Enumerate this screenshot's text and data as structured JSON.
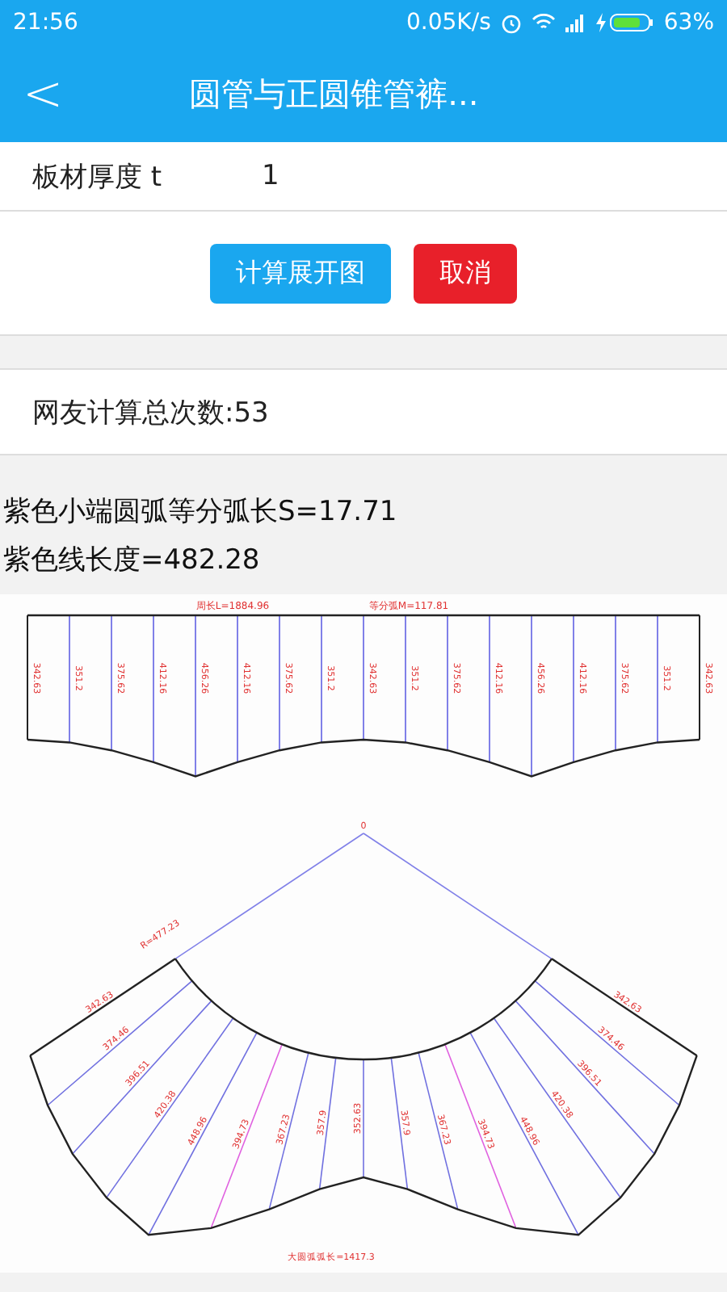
{
  "status_bar": {
    "time": "21:56",
    "speed": "0.05K/s",
    "battery": "63%"
  },
  "header": {
    "back": "<",
    "title": "圆管与正圆锥管裤..."
  },
  "field": {
    "label": "板材厚度 t",
    "value": "1"
  },
  "buttons": [
    {
      "label": "计算展开图",
      "kind": "primary"
    },
    {
      "label": "取消",
      "kind": "danger"
    }
  ],
  "count_text": "网友计算总次数:53",
  "results": [
    "紫色小端圆弧等分弧长S=17.71",
    "紫色线长度=482.28"
  ],
  "drawing": {
    "circumference": "周长L=1884.96",
    "division": "等分弧M=117.81",
    "strip_labels": [
      "342.63",
      "351.2",
      "375.62",
      "412.16",
      "456.26",
      "412.16",
      "375.62",
      "351.2",
      "342.63",
      "351.2",
      "375.62",
      "412.16",
      "456.26",
      "412.16",
      "375.62",
      "351.2",
      "342.63"
    ],
    "apex": "0",
    "radius": "R=477.23",
    "fan_labels": [
      "342.63",
      "374.46",
      "396.51",
      "420.38",
      "448.96",
      "394.73",
      "367.23",
      "357.9",
      "352.63",
      "357.9",
      "367.23",
      "394.73",
      "448.96",
      "420.38",
      "396.51",
      "374.46",
      "342.63"
    ],
    "arc_length": "大圆弧弧长=1417.3"
  }
}
